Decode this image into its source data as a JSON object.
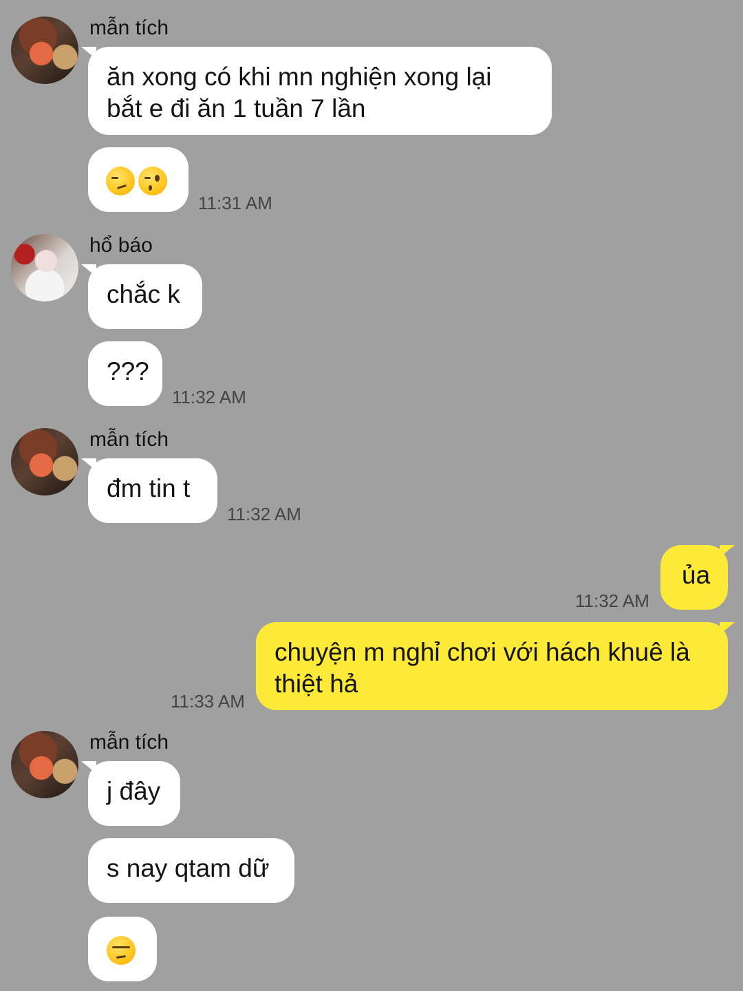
{
  "colors": {
    "background": "#a0a0a0",
    "bubble_in": "#ffffff",
    "bubble_out": "#fde937"
  },
  "messages": [
    {
      "sender": "mẫn tích",
      "avatar": "avatar-man-tich",
      "bubbles": [
        "ăn xong có khi mn nghiện xong lại",
        "bắt e đi ăn 1 tuần 7 lần"
      ],
      "emoji_bubble": [
        "smirk-emoji",
        "wink-emoji"
      ],
      "time": "11:31 AM"
    },
    {
      "sender": "hổ báo",
      "avatar": "avatar-ho-bao",
      "bubbles": [
        "chắc k",
        "???"
      ],
      "time": "11:32 AM"
    },
    {
      "sender": "mẫn tích",
      "avatar": "avatar-man-tich",
      "bubbles": [
        "đm tin t"
      ],
      "time": "11:32 AM"
    },
    {
      "sender": "me",
      "bubbles": [
        "ủa"
      ],
      "time": "11:32 AM"
    },
    {
      "sender": "me",
      "bubbles": [
        "chuyện m nghỉ chơi với hách khuê là",
        "thiệt hả"
      ],
      "time": "11:33 AM"
    },
    {
      "sender": "mẫn tích",
      "avatar": "avatar-man-tich",
      "bubbles": [
        "j đây",
        "s nay qtam dữ"
      ],
      "emoji_bubble": [
        "unamused-emoji"
      ]
    }
  ]
}
